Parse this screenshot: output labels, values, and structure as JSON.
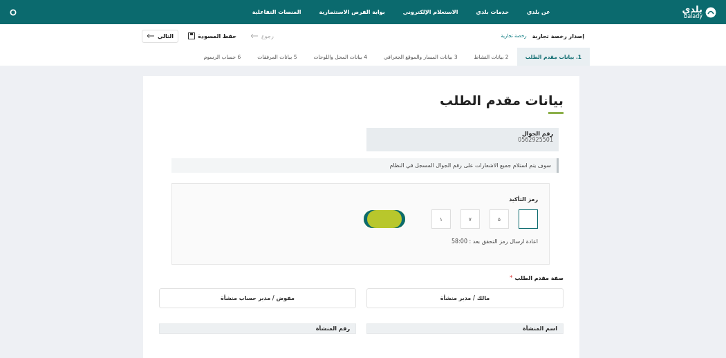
{
  "header": {
    "logo": "بلدي",
    "logo_sub": "balady",
    "nav": [
      "عن بلدي",
      "خدمات بلدي",
      "الاستعلام الإلكتروني",
      "بوابة الفرص الاستثمارية",
      "المنصات التفاعلية"
    ]
  },
  "breadcrumb": [
    "إصدار رخصة تجارية",
    "رخصة تجارية"
  ],
  "actions": [
    {
      "kind": "back",
      "label": "رجوع",
      "disabled": true
    },
    {
      "kind": "save",
      "label": "حفظ المسودة",
      "disabled": false
    },
    {
      "kind": "next",
      "label": "التالي",
      "disabled": false
    }
  ],
  "steps": [
    {
      "number": "1.",
      "label": "بيانات مقدم الطلب",
      "selected": true
    },
    {
      "number": "2",
      "label": "بيانات النشاط",
      "selected": false
    },
    {
      "number": "3",
      "label": "بيانات المسار والموقع الجغرافي",
      "selected": false
    },
    {
      "number": "4",
      "label": "بيانات المحل واللوحات",
      "selected": false
    },
    {
      "number": "5",
      "label": "بيانات المرفقات",
      "selected": false
    },
    {
      "number": "6",
      "label": "حساب الرسوم",
      "selected": false
    }
  ],
  "form": {
    "title": "بيانات مقدم الطلب",
    "phone": {
      "label": "رقم الجوال",
      "value": "0562925501"
    },
    "notice": "سوف يتم استلام جميع الاشعارات على رقم الجوال المسجل في النظام",
    "otp": {
      "label": "رمز التأكيد",
      "digits": [
        {
          "focused": true
        },
        {
          "value": "٥",
          "focused": false
        },
        {
          "value": "٧",
          "focused": false
        },
        {
          "value": "١",
          "focused": false
        }
      ],
      "resend": "اعادة ارسال رمز التحقق بعد : 58:00"
    },
    "applicant_type": {
      "label": "صفة مقدم الطلب",
      "required_mark": "*",
      "options": [
        {
          "label": "مالك / مدير منشأة",
          "selected": false
        },
        {
          "label": "مفوض / مدير حساب منشأة",
          "selected": false
        }
      ]
    },
    "fields": [
      {
        "label": "اسم المنشأة"
      },
      {
        "label": "رقم المنشأة"
      }
    ]
  }
}
